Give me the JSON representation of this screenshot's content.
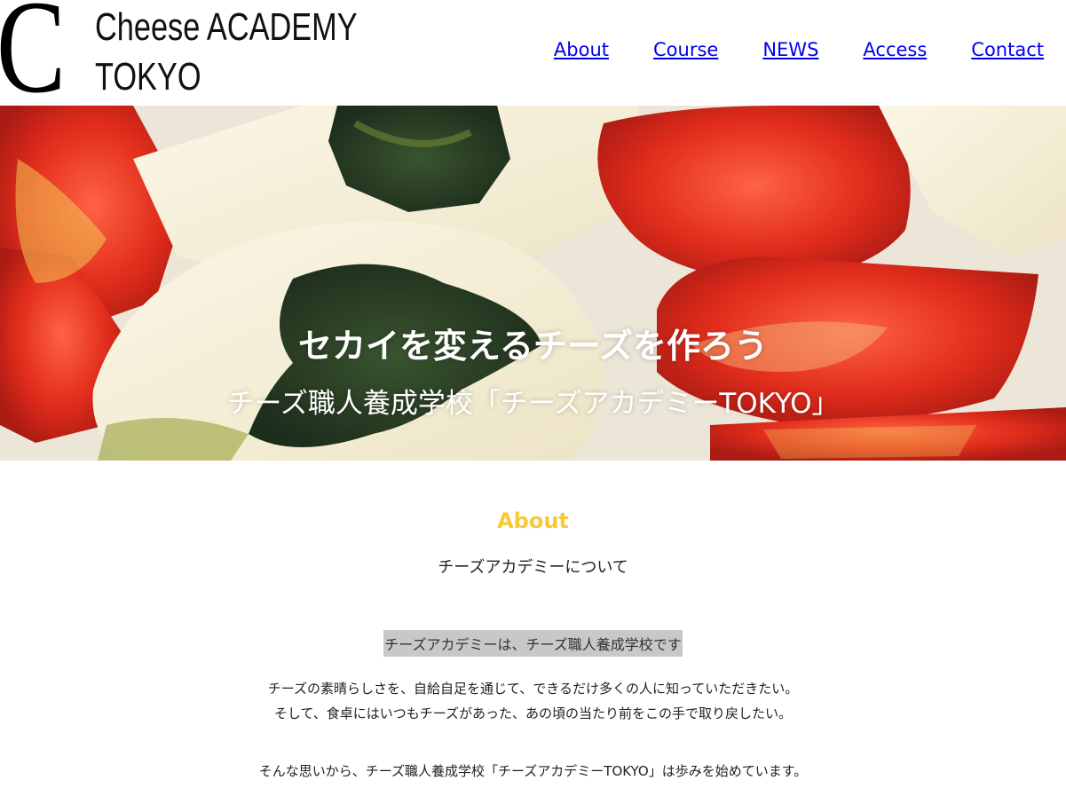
{
  "logo": {
    "letter": "C",
    "line1": "Cheese ACADEMY",
    "line2": "TOKYO"
  },
  "nav": {
    "items": [
      "About",
      "Course",
      "NEWS",
      "Access",
      "Contact"
    ]
  },
  "hero": {
    "title": "セカイを変えるチーズを作ろう",
    "subtitle": "チーズ職人養成学校「チーズアカデミーTOKYO」"
  },
  "about": {
    "heading": "About",
    "subheading": "チーズアカデミーについて",
    "lead": "チーズアカデミーは、チーズ職人養成学校です",
    "body_line1": "チーズの素晴らしさを、自給自足を通じて、できるだけ多くの人に知っていただきたい。",
    "body_line2": "そして、食卓にはいつもチーズがあった、あの頃の当たり前をこの手で取り戻したい。",
    "body_line3": "そんな思いから、チーズ職人養成学校「チーズアカデミーTOKYO」は歩みを始めています。"
  },
  "colors": {
    "accent": "#f6c935",
    "link": "#0000ee",
    "tomato": "#d81c0c",
    "cheese": "#f4efd8",
    "pesto": "#1f3a1c"
  }
}
